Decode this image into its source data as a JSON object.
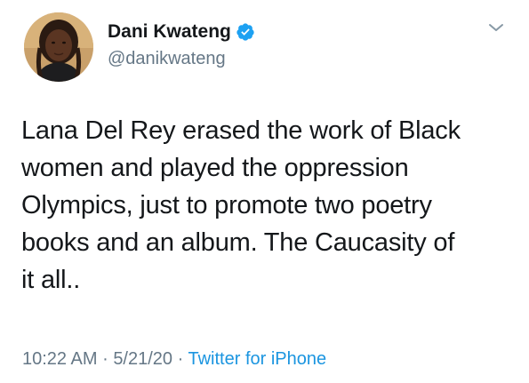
{
  "author": {
    "display_name": "Dani Kwateng",
    "handle": "@danikwateng",
    "verified": true,
    "avatar_icon": "profile-photo"
  },
  "tweet": {
    "lines": [
      "Lana Del Rey erased the work of Black",
      "women and played the oppression",
      "Olympics, just to promote two poetry",
      "books and an album. The Caucasity of",
      "it all.."
    ]
  },
  "meta": {
    "time": "10:22 AM",
    "separator": "·",
    "date": "5/21/20",
    "source": "Twitter for iPhone"
  },
  "colors": {
    "text": "#14171a",
    "secondary": "#657786",
    "link": "#1b95e0",
    "verified": "#1da1f2"
  }
}
